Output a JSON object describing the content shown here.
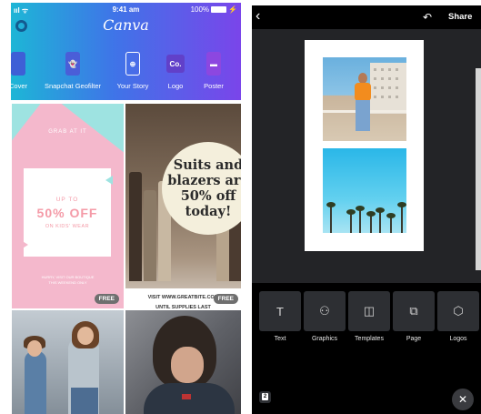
{
  "left_app": {
    "status": {
      "signal": "ııl ᯤ",
      "time": "9:41 am",
      "battery": "100%"
    },
    "brand": "Canva",
    "categories": [
      {
        "label": "Cover",
        "icon": "cover-icon",
        "color": "#3e5fd6"
      },
      {
        "label": "Snapchat Geofilter",
        "icon": "ghost-icon",
        "color": "#4a5ed8"
      },
      {
        "label": "Your Story",
        "icon": "phone-story-icon",
        "color": "#ffffff"
      },
      {
        "label": "Logo",
        "icon": "logo-co-icon",
        "glyph": "Co.",
        "color": "#6140c9"
      },
      {
        "label": "Poster",
        "icon": "poster-icon",
        "color": "#8c47e0"
      }
    ],
    "templates": [
      {
        "name": "kids-sale",
        "header": "GRAB AT IT",
        "up_to": "UP TO",
        "discount": "50% OFF",
        "subtitle": "ON KIDS' WEAR",
        "fine_print_1": "HURRY, VISIT OUR BOUTIQUE",
        "fine_print_2": "THIS WEEKEND ONLY",
        "badge": "FREE",
        "colors": {
          "teal": "#9ee3e1",
          "pink": "#f4b8cc",
          "text": "#f49aa7"
        }
      },
      {
        "name": "suits-sale",
        "headline_1": "Suits and",
        "headline_2": "blazers are",
        "headline_3": "50% off",
        "headline_4": "today!",
        "footer_1": "VISIT WWW.GREATBITE.COM",
        "footer_2": "UNTIL SUPPLIES LAST",
        "badge": "FREE"
      },
      {
        "name": "mother-daughter-photo"
      },
      {
        "name": "woman-portrait-photo"
      }
    ]
  },
  "right_app": {
    "toolbar": {
      "back_icon": "chevron-left-icon",
      "undo_icon": "undo-icon",
      "share_label": "Share"
    },
    "tools": [
      {
        "label": "Text",
        "icon": "text-T-icon",
        "glyph": "T"
      },
      {
        "label": "Graphics",
        "icon": "shapes-icon",
        "glyph": "⚇"
      },
      {
        "label": "Templates",
        "icon": "templates-icon",
        "glyph": "◫"
      },
      {
        "label": "Page",
        "icon": "page-icon",
        "glyph": "⧉"
      },
      {
        "label": "Logos",
        "icon": "logo-hex-icon",
        "glyph": "⬡"
      }
    ],
    "page_count": "2",
    "close_glyph": "✕"
  }
}
